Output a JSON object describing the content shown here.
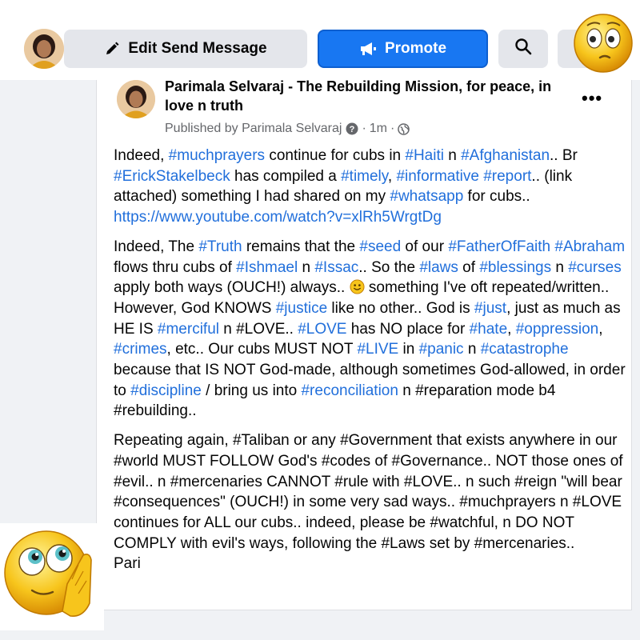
{
  "toolbar": {
    "edit_label": "Edit Send Message",
    "promote_label": "Promote",
    "search_icon": "search-icon",
    "accent_color": "#1877f2"
  },
  "post": {
    "page_name": "Parimala Selvaraj - The Rebuilding Mission, for peace, in love n truth",
    "published_by": "Published by Parimala Selvaraj",
    "time": "1m",
    "audience_icon": "globe-icon",
    "more_icon": "more-dots-icon"
  },
  "paragraphs": [
    [
      {
        "t": "Indeed, "
      },
      {
        "t": "#muchprayers",
        "h": 1
      },
      {
        "t": " continue for cubs in "
      },
      {
        "t": "#Haiti",
        "h": 1
      },
      {
        "t": " n "
      },
      {
        "t": "#Afghanistan",
        "h": 1
      },
      {
        "t": ".. Br "
      },
      {
        "t": "#ErickStakelbeck",
        "h": 1
      },
      {
        "t": " has compiled a "
      },
      {
        "t": "#timely",
        "h": 1
      },
      {
        "t": ", "
      },
      {
        "t": "#informative",
        "h": 1
      },
      {
        "t": " "
      },
      {
        "t": "#report",
        "h": 1
      },
      {
        "t": ".. (link attached) something I had shared on my "
      },
      {
        "t": "#whatsapp",
        "h": 1
      },
      {
        "t": " for cubs.. "
      },
      {
        "t": "https://www.youtube.com/watch?v=xlRh5WrgtDg",
        "h": 1
      }
    ],
    [
      {
        "t": "Indeed, The "
      },
      {
        "t": "#Truth",
        "h": 1
      },
      {
        "t": " remains that the "
      },
      {
        "t": "#seed",
        "h": 1
      },
      {
        "t": " of our "
      },
      {
        "t": "#FatherOfFaith",
        "h": 1
      },
      {
        "t": " "
      },
      {
        "t": "#Abraham",
        "h": 1
      },
      {
        "t": " flows thru cubs of "
      },
      {
        "t": "#Ishmael",
        "h": 1
      },
      {
        "t": " n "
      },
      {
        "t": "#Issac",
        "h": 1
      },
      {
        "t": ".. So the "
      },
      {
        "t": "#laws",
        "h": 1
      },
      {
        "t": " of "
      },
      {
        "t": "#blessings",
        "h": 1
      },
      {
        "t": " n "
      },
      {
        "t": "#curses",
        "h": 1
      },
      {
        "t": " apply both ways (OUCH!) always.. "
      },
      {
        "e": "slightly-smiling-face-emoji"
      },
      {
        "t": " something I've oft repeated/written.. However, God KNOWS "
      },
      {
        "t": "#justice",
        "h": 1
      },
      {
        "t": " like no other.. God is "
      },
      {
        "t": "#just",
        "h": 1
      },
      {
        "t": ", just as much as HE IS "
      },
      {
        "t": "#merciful",
        "h": 1
      },
      {
        "t": " n #LOVE.. "
      },
      {
        "t": "#LOVE",
        "h": 1
      },
      {
        "t": " has NO place for "
      },
      {
        "t": "#hate",
        "h": 1
      },
      {
        "t": ", "
      },
      {
        "t": "#oppression",
        "h": 1
      },
      {
        "t": ", "
      },
      {
        "t": "#crimes",
        "h": 1
      },
      {
        "t": ", etc.. Our cubs MUST NOT "
      },
      {
        "t": "#LIVE",
        "h": 1
      },
      {
        "t": " in "
      },
      {
        "t": "#panic",
        "h": 1
      },
      {
        "t": " n "
      },
      {
        "t": "#catastrophe",
        "h": 1
      },
      {
        "t": " because that IS NOT God-made, although sometimes God-allowed, in order to "
      },
      {
        "t": "#discipline",
        "h": 1
      },
      {
        "t": " / bring us into "
      },
      {
        "t": "#reconciliation",
        "h": 1
      },
      {
        "t": " n #reparation mode b4 #rebuilding.."
      }
    ],
    [
      {
        "t": "Repeating again, #Taliban or any #Government that exists anywhere in our #world MUST FOLLOW God's #codes of #Governance.. NOT those ones of #evil.. n #mercenaries CANNOT #rule with #LOVE.. n such #reign \"will bear #consequences\" (OUCH!) in some very sad ways.. #muchprayers n #LOVE continues for ALL our cubs.. indeed, please be #watchful, n DO NOT COMPLY with evil's ways, following the #Laws set by #mercenaries.."
      },
      {
        "br": 1
      },
      {
        "t": "Pari"
      }
    ]
  ],
  "stickers": [
    "thinking-emoji-icon",
    "praying-emoji-icon"
  ]
}
